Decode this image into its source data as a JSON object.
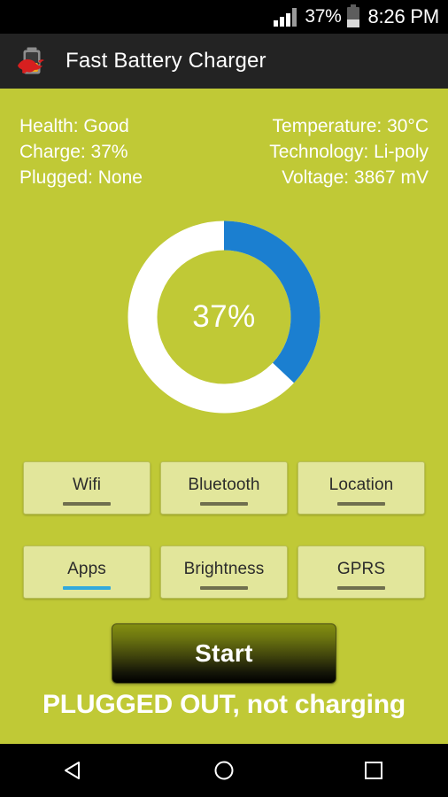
{
  "statusbar": {
    "signal_icon": "signal-bars-icon",
    "battery_percent": "37%",
    "battery_icon": "battery-icon",
    "time": "8:26 PM"
  },
  "actionbar": {
    "icon": "app-logo-battery-bull-icon",
    "title": "Fast Battery Charger",
    "background_color": "#232323"
  },
  "theme": {
    "background_color": "#c0c936",
    "accent_blue": "#1b7fd0",
    "ring_track_color": "#ffffff",
    "button_fill": "#e2e69b",
    "toggle_bar_off": "#6f6f4e",
    "toggle_bar_on": "#31a9dd"
  },
  "info": {
    "left": [
      "Health: Good",
      "Charge: 37%",
      "Plugged: None"
    ],
    "right": [
      "Temperature: 30°C",
      "Technology: Li-poly",
      "Voltage: 3867 mV"
    ]
  },
  "gauge": {
    "percent": 37,
    "label": "37%",
    "filled_color": "#1b7fd0",
    "track_color": "#ffffff"
  },
  "toggles": {
    "row1": [
      {
        "label": "Wifi",
        "active": false
      },
      {
        "label": "Bluetooth",
        "active": false
      },
      {
        "label": "Location",
        "active": false
      }
    ],
    "row2": [
      {
        "label": "Apps",
        "active": true
      },
      {
        "label": "Brightness",
        "active": false
      },
      {
        "label": "GPRS",
        "active": false
      }
    ]
  },
  "start_button": {
    "label": "Start"
  },
  "status_message": {
    "text": "PLUGGED OUT, not charging"
  },
  "navbar": {
    "back": "back-triangle-icon",
    "home": "home-circle-icon",
    "recents": "recents-square-icon"
  }
}
